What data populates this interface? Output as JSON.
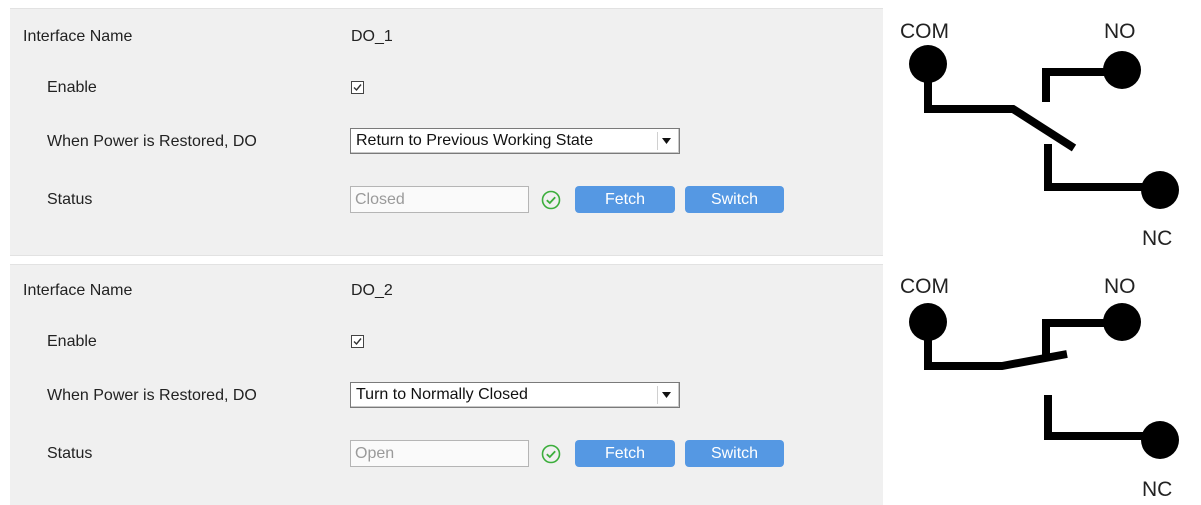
{
  "interfaces": [
    {
      "name_label": "Interface Name",
      "name_value": "DO_1",
      "enable_label": "Enable",
      "enable_checked": true,
      "power_label": "When Power is Restored, DO",
      "power_value": "Return to Previous Working State",
      "status_label": "Status",
      "status_value": "Closed",
      "fetch_label": "Fetch",
      "switch_label": "Switch",
      "diagram": {
        "com": "COM",
        "no": "NO",
        "nc": "NC",
        "state": "closed"
      }
    },
    {
      "name_label": "Interface Name",
      "name_value": "DO_2",
      "enable_label": "Enable",
      "enable_checked": true,
      "power_label": "When Power is Restored, DO",
      "power_value": "Turn to Normally Closed",
      "status_label": "Status",
      "status_value": "Open",
      "fetch_label": "Fetch",
      "switch_label": "Switch",
      "diagram": {
        "com": "COM",
        "no": "NO",
        "nc": "NC",
        "state": "open"
      }
    }
  ],
  "colors": {
    "button": "#5598e3",
    "ok": "#3cae3c",
    "panel": "#f0f0f0"
  },
  "icons": {
    "status_ok": "check-circle-icon",
    "dropdown": "chevron-down-icon",
    "checkbox": "checkmark-icon"
  }
}
